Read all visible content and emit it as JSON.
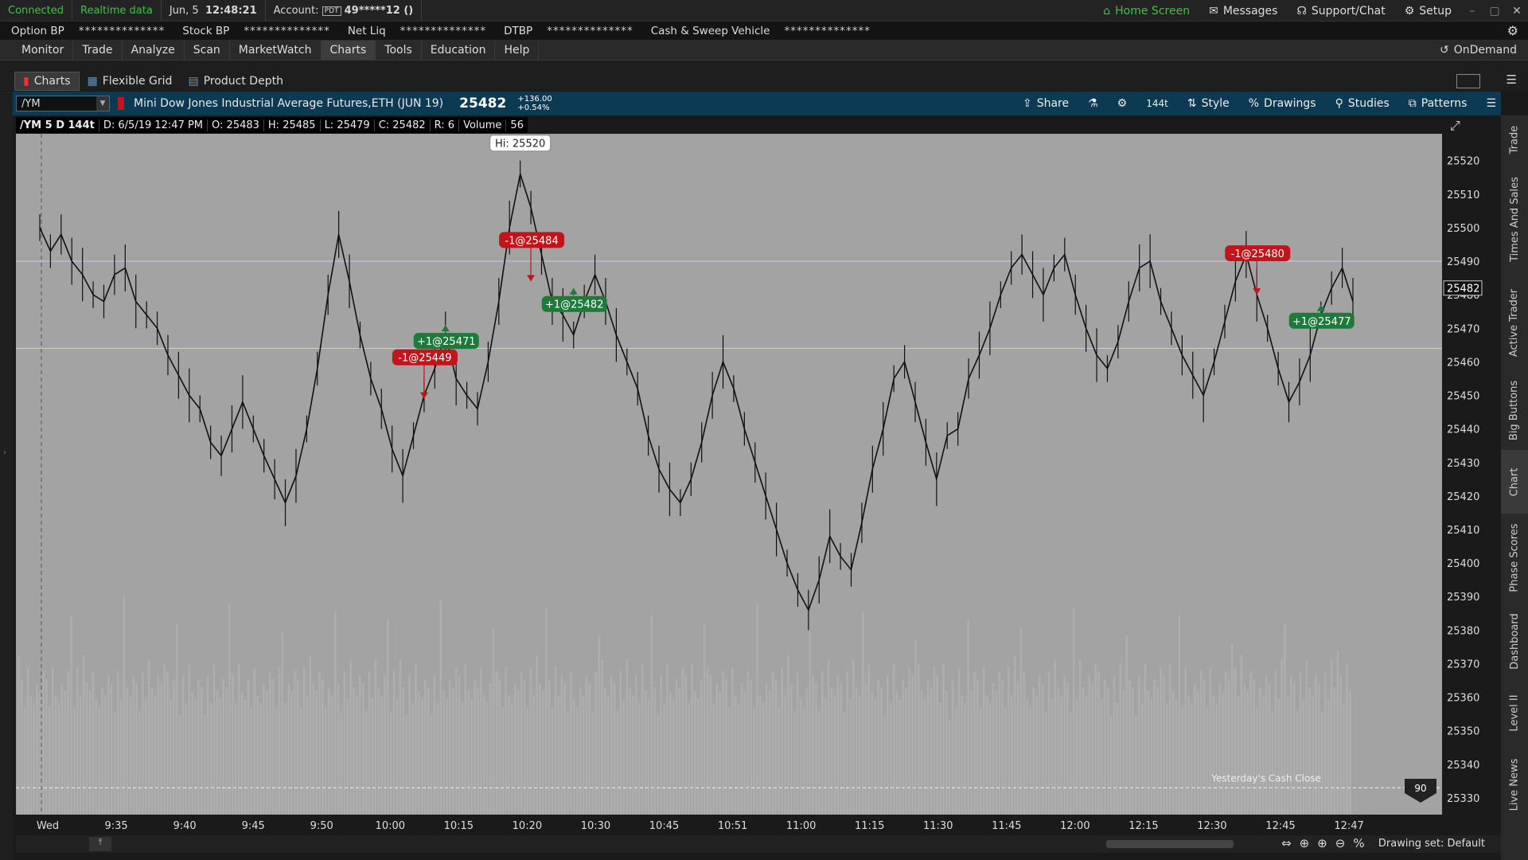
{
  "status": {
    "connected": "Connected",
    "realtime": "Realtime data",
    "date": "Jun, 5",
    "time": "12:48:21",
    "account_label": "Account:",
    "account_badge": "PDT",
    "account_value": "49*****12 ()"
  },
  "top_tools": {
    "home": "Home Screen",
    "messages": "Messages",
    "support": "Support/Chat",
    "setup": "Setup"
  },
  "balances": [
    {
      "label": "Option BP",
      "value": "**************"
    },
    {
      "label": "Stock BP",
      "value": "**************"
    },
    {
      "label": "Net Liq",
      "value": "**************"
    },
    {
      "label": "DTBP",
      "value": "**************"
    },
    {
      "label": "Cash & Sweep Vehicle",
      "value": "**************"
    }
  ],
  "menu": [
    "Monitor",
    "Trade",
    "Analyze",
    "Scan",
    "MarketWatch",
    "Charts",
    "Tools",
    "Education",
    "Help"
  ],
  "menu_active": "Charts",
  "ondemand": "OnDemand",
  "subtabs": [
    "Charts",
    "Flexible Grid",
    "Product Depth"
  ],
  "symbol": {
    "ticker": "/YM",
    "description": "Mini Dow Jones Industrial Average Futures,ETH (JUN 19)",
    "price": "25482",
    "change": "+136.00",
    "change_pct": "+0.54%"
  },
  "chart_tools": [
    "Share",
    "144t",
    "Style",
    "Drawings",
    "Studies",
    "Patterns"
  ],
  "ohlc": {
    "sym": "/YM 5 D 144t",
    "date": "D: 6/5/19 12:47 PM",
    "open": "O: 25483",
    "high": "H: 25485",
    "low": "L: 25479",
    "close": "C: 25482",
    "range": "R: 6",
    "vol_label": "Volume",
    "vol": "56"
  },
  "chart_data": {
    "type": "line",
    "xlabel": "",
    "ylabel": "",
    "ylim": [
      25325,
      25528
    ],
    "yticks": [
      25520,
      25510,
      25500,
      25490,
      25480,
      25470,
      25460,
      25450,
      25440,
      25430,
      25420,
      25410,
      25400,
      25390,
      25380,
      25370,
      25360,
      25350,
      25340,
      25330
    ],
    "xticks": [
      "Wed",
      "9:35",
      "9:40",
      "9:45",
      "9:50",
      "10:00",
      "10:15",
      "10:20",
      "10:30",
      "10:45",
      "10:51",
      "11:00",
      "11:15",
      "11:30",
      "11:45",
      "12:00",
      "12:15",
      "12:30",
      "12:45",
      "12:47"
    ],
    "series": [
      {
        "values": [
          25500,
          25493,
          25498,
          25490,
          25486,
          25480,
          25478,
          25486,
          25488,
          25478,
          25474,
          25470,
          25462,
          25456,
          25450,
          25446,
          25436,
          25432,
          25440,
          25448,
          25440,
          25432,
          25425,
          25418,
          25426,
          25440,
          25458,
          25480,
          25498,
          25484,
          25468,
          25455,
          25446,
          25434,
          25426,
          25438,
          25450,
          25458,
          25468,
          25455,
          25450,
          25446,
          25460,
          25478,
          25500,
          25516,
          25506,
          25492,
          25478,
          25474,
          25468,
          25478,
          25486,
          25478,
          25468,
          25460,
          25452,
          25438,
          25428,
          25422,
          25418,
          25425,
          25436,
          25450,
          25460,
          25452,
          25440,
          25430,
          25420,
          25410,
          25400,
          25392,
          25386,
          25395,
          25408,
          25402,
          25398,
          25412,
          25428,
          25440,
          25455,
          25460,
          25448,
          25436,
          25425,
          25438,
          25440,
          25455,
          25462,
          25470,
          25480,
          25488,
          25492,
          25486,
          25480,
          25488,
          25492,
          25480,
          25470,
          25462,
          25458,
          25466,
          25478,
          25488,
          25490,
          25478,
          25470,
          25462,
          25456,
          25450,
          25460,
          25472,
          25484,
          25492,
          25480,
          25470,
          25458,
          25448,
          25454,
          25462,
          25474,
          25482,
          25488,
          25478
        ],
        "name": ""
      }
    ],
    "price_lines": [
      25490,
      25464
    ],
    "hi_label": "Hi: 25520",
    "last_price_label": "25482",
    "trades": [
      {
        "label": "-1@25484",
        "side": "sell",
        "x_index": 46,
        "price": 25484
      },
      {
        "label": "-1@25449",
        "side": "sell",
        "x_index": 36,
        "price": 25449
      },
      {
        "label": "+1@25482",
        "side": "buy",
        "x_index": 50,
        "price": 25482
      },
      {
        "label": "+1@25471",
        "side": "buy",
        "x_index": 38,
        "price": 25471
      },
      {
        "label": "-1@25480",
        "side": "sell",
        "x_index": 114,
        "price": 25480
      },
      {
        "label": "+1@25477",
        "side": "buy",
        "x_index": 120,
        "price": 25477
      }
    ],
    "yesterday_label": "Yesterday's Cash Close",
    "marker_90": "90"
  },
  "bottom": {
    "drawing_set": "Drawing set: Default"
  },
  "right_tabs": [
    "Trade",
    "Times And Sales",
    "Active Trader",
    "Big Buttons",
    "Chart",
    "Phase Scores",
    "Dashboard",
    "Level II",
    "Live News"
  ],
  "colors": {
    "connected": "#3ec24a",
    "sell": "#c0151a",
    "buy": "#1e7a3a",
    "chart_bg": "#a3a3a3",
    "symbar": "#0c3a52"
  }
}
